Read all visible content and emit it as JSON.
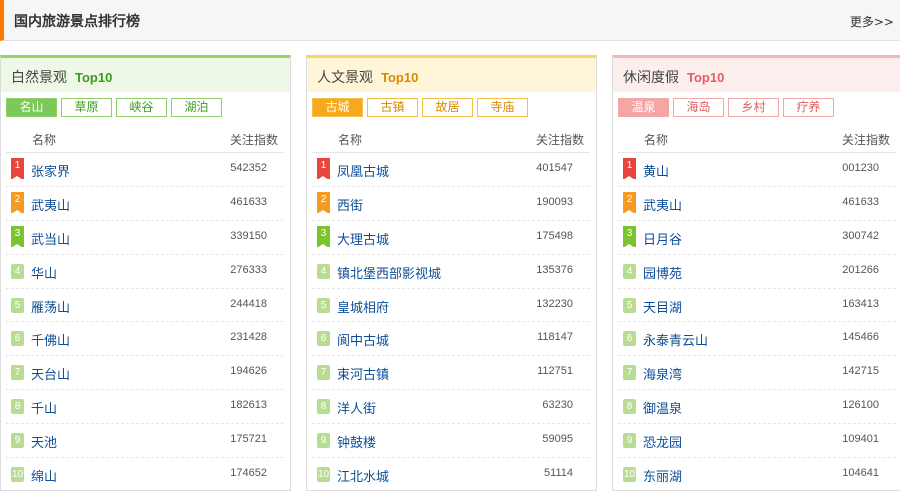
{
  "header": {
    "title": "国内旅游景点排行榜",
    "more_label": "更多>>"
  },
  "panels": [
    {
      "title": "白然景观",
      "top_label": "Top10",
      "tabs": [
        "名山",
        "草原",
        "峡谷",
        "湖泊"
      ],
      "active_tab": "名山",
      "col_name": "名称",
      "col_index": "关注指数",
      "rows": [
        {
          "rank": "1",
          "name": "张家界",
          "index": "542352"
        },
        {
          "rank": "2",
          "name": "武夷山",
          "index": "461633"
        },
        {
          "rank": "3",
          "name": "武当山",
          "index": "339150"
        },
        {
          "rank": "4",
          "name": "华山",
          "index": "276333"
        },
        {
          "rank": "5",
          "name": "雁荡山",
          "index": "244418"
        },
        {
          "rank": "6",
          "name": "千佛山",
          "index": "231428"
        },
        {
          "rank": "7",
          "name": "天台山",
          "index": "194626"
        },
        {
          "rank": "8",
          "name": "千山",
          "index": "182613"
        },
        {
          "rank": "9",
          "name": "天池",
          "index": "175721"
        },
        {
          "rank": "10",
          "name": "绵山",
          "index": "174652"
        }
      ]
    },
    {
      "title": "人文景观",
      "top_label": "Top10",
      "tabs": [
        "古城",
        "古镇",
        "故居",
        "寺庙"
      ],
      "active_tab": "古城",
      "col_name": "名称",
      "col_index": "关注指数",
      "rows": [
        {
          "rank": "1",
          "name": "凤凰古城",
          "index": "401547"
        },
        {
          "rank": "2",
          "name": "西街",
          "index": "190093"
        },
        {
          "rank": "3",
          "name": "大理古城",
          "index": "175498"
        },
        {
          "rank": "4",
          "name": "镇北堡西部影视城",
          "index": "135376"
        },
        {
          "rank": "5",
          "name": "皇城相府",
          "index": "132230"
        },
        {
          "rank": "6",
          "name": "阆中古城",
          "index": "118147"
        },
        {
          "rank": "7",
          "name": "束河古镇",
          "index": "112751"
        },
        {
          "rank": "8",
          "name": "洋人街",
          "index": "63230"
        },
        {
          "rank": "9",
          "name": "钟鼓楼",
          "index": "59095"
        },
        {
          "rank": "10",
          "name": "江北水城",
          "index": "51114"
        }
      ]
    },
    {
      "title": "休闲度假",
      "top_label": "Top10",
      "tabs": [
        "温泉",
        "海岛",
        "乡村",
        "疗养"
      ],
      "active_tab": "温泉",
      "col_name": "名称",
      "col_index": "关注指数",
      "rows": [
        {
          "rank": "1",
          "name": "黄山",
          "index": "001230"
        },
        {
          "rank": "2",
          "name": "武夷山",
          "index": "461633"
        },
        {
          "rank": "3",
          "name": "日月谷",
          "index": "300742"
        },
        {
          "rank": "4",
          "name": "园博苑",
          "index": "201266"
        },
        {
          "rank": "5",
          "name": "天目湖",
          "index": "163413"
        },
        {
          "rank": "6",
          "name": "永泰青云山",
          "index": "145466"
        },
        {
          "rank": "7",
          "name": "海泉湾",
          "index": "142715"
        },
        {
          "rank": "8",
          "name": "御温泉",
          "index": "126100"
        },
        {
          "rank": "9",
          "name": "恐龙园",
          "index": "109401"
        },
        {
          "rank": "10",
          "name": "东丽湖",
          "index": "104641"
        }
      ]
    }
  ]
}
